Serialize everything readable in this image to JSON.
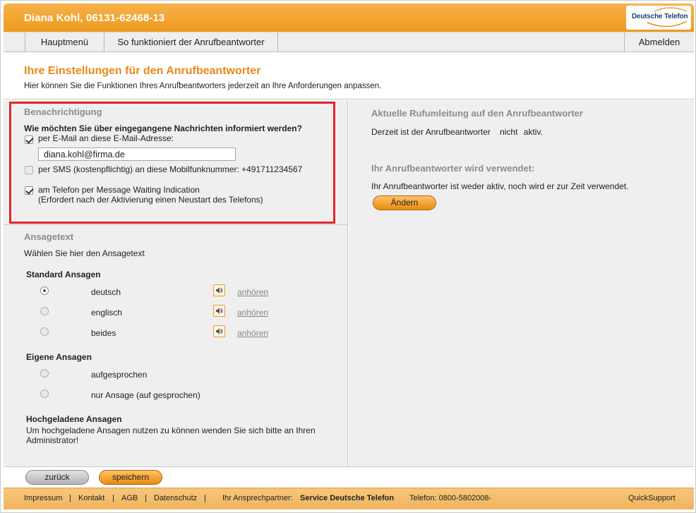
{
  "header": {
    "user": "Diana Kohl, 06131-62468-13",
    "logo": "Deutsche Telefon"
  },
  "nav": {
    "main_menu": "Hauptmenü",
    "how_it_works": "So funktioniert der Anrufbeantworter",
    "logout": "Abmelden"
  },
  "intro": {
    "title": "Ihre Einstellungen für den Anrufbeantworter",
    "subtitle": "Hier können Sie die Funktionen Ihres Anrufbeantworters jederzeit an Ihre Anforderungen anpassen."
  },
  "notification": {
    "heading": "Benachrichtigung",
    "question": "Wie möchten Sie über eingegangene Nachrichten informiert werden?",
    "email_label": "per E-Mail an diese E-Mail-Adresse:",
    "email_checked": true,
    "email_value": "diana.kohl@firma.de",
    "sms_label": "per SMS (kostenpflichtig) an diese Mobilfunknummer: +491711234567",
    "sms_checked": false,
    "mwi_label": "am Telefon per Message Waiting Indication",
    "mwi_note": "(Erfordert nach der Aktivierung einen Neustart des Telefons)",
    "mwi_checked": true
  },
  "greeting": {
    "heading": "Ansagetext",
    "intro": "Wählen Sie hier den Ansagetext",
    "standard_heading": "Standard Ansagen",
    "standard_options": [
      {
        "label": "deutsch",
        "selected": true,
        "listen": "anhören"
      },
      {
        "label": "englisch",
        "selected": false,
        "listen": "anhören"
      },
      {
        "label": "beides",
        "selected": false,
        "listen": "anhören"
      }
    ],
    "own_heading": "Eigene Ansagen",
    "own_options": [
      {
        "label": "aufgesprochen",
        "selected": false
      },
      {
        "label": "nur Ansage (auf gesprochen)",
        "selected": false
      }
    ],
    "uploaded_heading": "Hochgeladene Ansagen",
    "uploaded_text_1": "Um hochgeladene Ansagen nutzen zu können wenden Sie sich bitte an Ihren",
    "uploaded_text_2": "Administrator!"
  },
  "forwarding": {
    "heading": "Aktuelle Rufumleitung auf den Anrufbeantworter",
    "status_prefix": "Derzeit ist der Anrufbeantworter",
    "status_word": "nicht",
    "status_suffix": "aktiv."
  },
  "usage": {
    "heading": "Ihr Anrufbeantworter wird verwendet:",
    "text": "Ihr Anrufbeantworter ist weder aktiv, noch wird er zur Zeit verwendet.",
    "change_button": "Ändern"
  },
  "actions": {
    "back": "zurück",
    "save": "speichern"
  },
  "footer": {
    "imprint": "Impressum",
    "contact": "Kontakt",
    "terms": "AGB",
    "privacy": "Datenschutz",
    "separator": "|",
    "contact_person_label": "Ihr Ansprechpartner:",
    "contact_person": "Service Deutsche Telefon",
    "phone": "Telefon: 0800-5802008-",
    "quicksupport": "QuickSupport"
  },
  "colors": {
    "accent": "#e8891a",
    "highlight": "#e0262e",
    "header": "#ee9a1e"
  }
}
